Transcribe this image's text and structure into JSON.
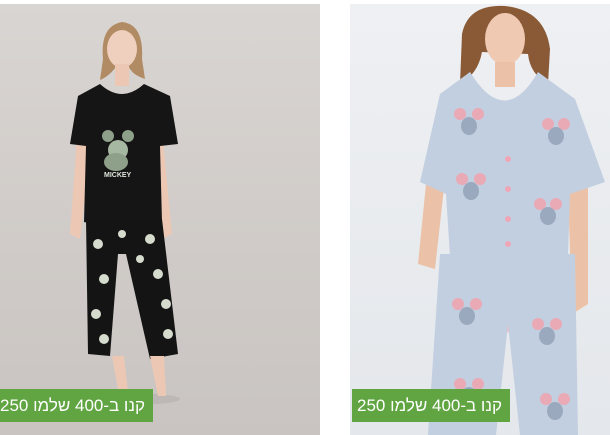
{
  "products": [
    {
      "image_alt": "Mickey pajama set",
      "print_text": "MICKEY",
      "promo_label": "קנו ב-400 שלמו 250"
    },
    {
      "image_alt": "Light blue mouse print pajama set",
      "promo_label": "קנו ב-400 שלמו 250"
    }
  ],
  "colors": {
    "promo_green": "#61a542",
    "card1_bg": "#d3cfcc",
    "card2_bg": "#e8eaee"
  }
}
